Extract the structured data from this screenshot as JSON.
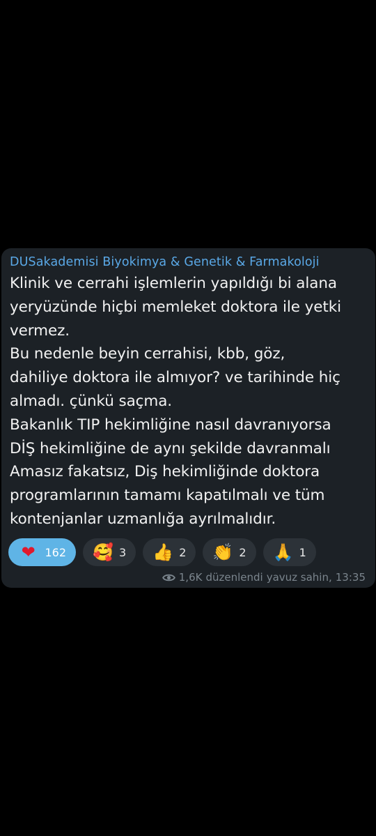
{
  "message": {
    "sender": "DUSakademisi Biyokimya & Genetik & Farmakoloji",
    "lines": [
      "Klinik ve cerrahi işlemlerin yapıldığı bi alana",
      "yeryüzünde hiçbi memleket doktora ile yetki",
      "vermez.",
      "Bu nedenle beyin cerrahisi, kbb, göz,",
      "dahiliye doktora ile almıyor? ve tarihinde hiç",
      "almadı. çünkü saçma.",
      "Bakanlık TIP hekimliğine nasıl davranıyorsa",
      "DİŞ hekimliğine de aynı şekilde davranmalı",
      "Amasız fakatsız, Diş hekimliğinde doktora",
      "programlarının tamamı kapatılmalı ve tüm",
      "kontenjanlar uzmanlığa ayrılmalıdır."
    ],
    "reactions": [
      {
        "emoji": "❤",
        "icon": "red-heart-icon",
        "count": "162",
        "active": true
      },
      {
        "emoji": "🥰",
        "icon": "smiling-face-with-hearts-icon",
        "count": "3"
      },
      {
        "emoji": "👍",
        "icon": "thumbs-up-icon",
        "count": "2"
      },
      {
        "emoji": "👏",
        "icon": "clapping-hands-icon",
        "count": "2"
      },
      {
        "emoji": "🙏",
        "icon": "folded-hands-icon",
        "count": "1"
      }
    ],
    "meta": {
      "views": "1,6K",
      "edited": "düzenlendi",
      "author": "yavuz sahin,",
      "time": "13:35"
    }
  },
  "colors": {
    "background": "#000000",
    "bubble": "#1c2126",
    "sender": "#5aa8e6",
    "text": "#f2f2f2",
    "reaction_active": "#5fb4e6",
    "reaction": "#2c3238",
    "meta": "#7b858d"
  }
}
